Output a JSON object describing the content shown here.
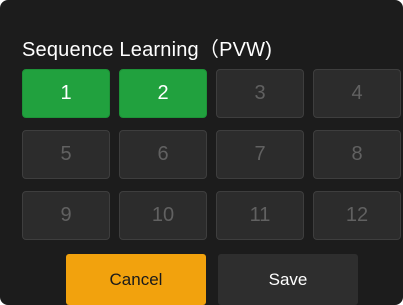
{
  "dialog": {
    "title": "Sequence Learning（PVW)"
  },
  "grid": {
    "cells": [
      {
        "label": "1",
        "active": true
      },
      {
        "label": "2",
        "active": true
      },
      {
        "label": "3",
        "active": false
      },
      {
        "label": "4",
        "active": false
      },
      {
        "label": "5",
        "active": false
      },
      {
        "label": "6",
        "active": false
      },
      {
        "label": "7",
        "active": false
      },
      {
        "label": "8",
        "active": false
      },
      {
        "label": "9",
        "active": false
      },
      {
        "label": "10",
        "active": false
      },
      {
        "label": "11",
        "active": false
      },
      {
        "label": "12",
        "active": false
      }
    ]
  },
  "buttons": {
    "cancel_label": "Cancel",
    "save_label": "Save"
  },
  "colors": {
    "background": "#1c1c1c",
    "active_cell": "#21a13e",
    "inactive_cell": "#2c2c2c",
    "cancel_button": "#f2a20d",
    "save_button": "#2e2e2e"
  }
}
